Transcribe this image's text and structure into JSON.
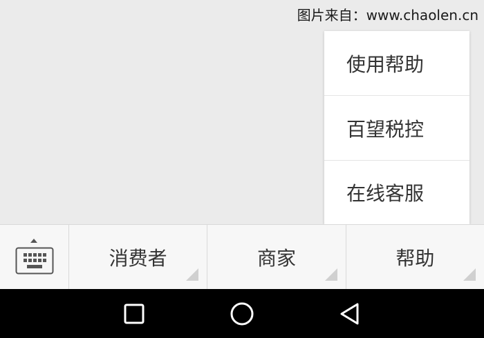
{
  "watermark": "图片来自：www.chaolen.cn",
  "popup_menu": {
    "items": [
      "使用帮助",
      "百望税控",
      "在线客服"
    ]
  },
  "bottom_menu": {
    "tabs": [
      "消费者",
      "商家",
      "帮助"
    ]
  },
  "icons": {
    "keyboard": "keyboard-icon",
    "expand": "caret-up-icon",
    "nav_back": "back-triangle-icon",
    "nav_home": "home-circle-icon",
    "nav_recent": "recent-square-icon"
  },
  "colors": {
    "background": "#ebebeb",
    "menu_bar": "#f7f7f7",
    "popup": "#ffffff",
    "nav_bar": "#000000",
    "text": "#333333"
  }
}
